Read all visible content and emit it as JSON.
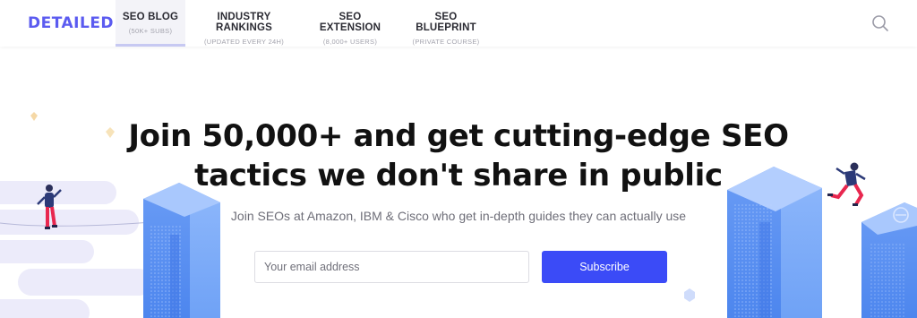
{
  "brand": {
    "logo_text": "DETAILED",
    "color": "#5b5bf0"
  },
  "nav": {
    "items": [
      {
        "label": "SEO BLOG",
        "sub": "(50K+ SUBS)",
        "active": true
      },
      {
        "label": "INDUSTRY RANKINGS",
        "sub": "(UPDATED EVERY 24H)",
        "active": false
      },
      {
        "label": "SEO EXTENSION",
        "sub": "(8,000+ USERS)",
        "active": false
      },
      {
        "label": "SEO BLUEPRINT",
        "sub": "(PRIVATE COURSE)",
        "active": false
      }
    ],
    "search_icon": "search-icon"
  },
  "hero": {
    "headline_line1": "Join 50,000+ and get cutting-edge SEO",
    "headline_line2": "tactics we don't share in public",
    "subline": "Join SEOs at Amazon, IBM & Cisco who get in-depth guides they can actually use",
    "email_placeholder": "Your email address",
    "subscribe_label": "Subscribe"
  },
  "colors": {
    "accent": "#3b4bf7",
    "illustration_blue": "#5a8ef0"
  }
}
